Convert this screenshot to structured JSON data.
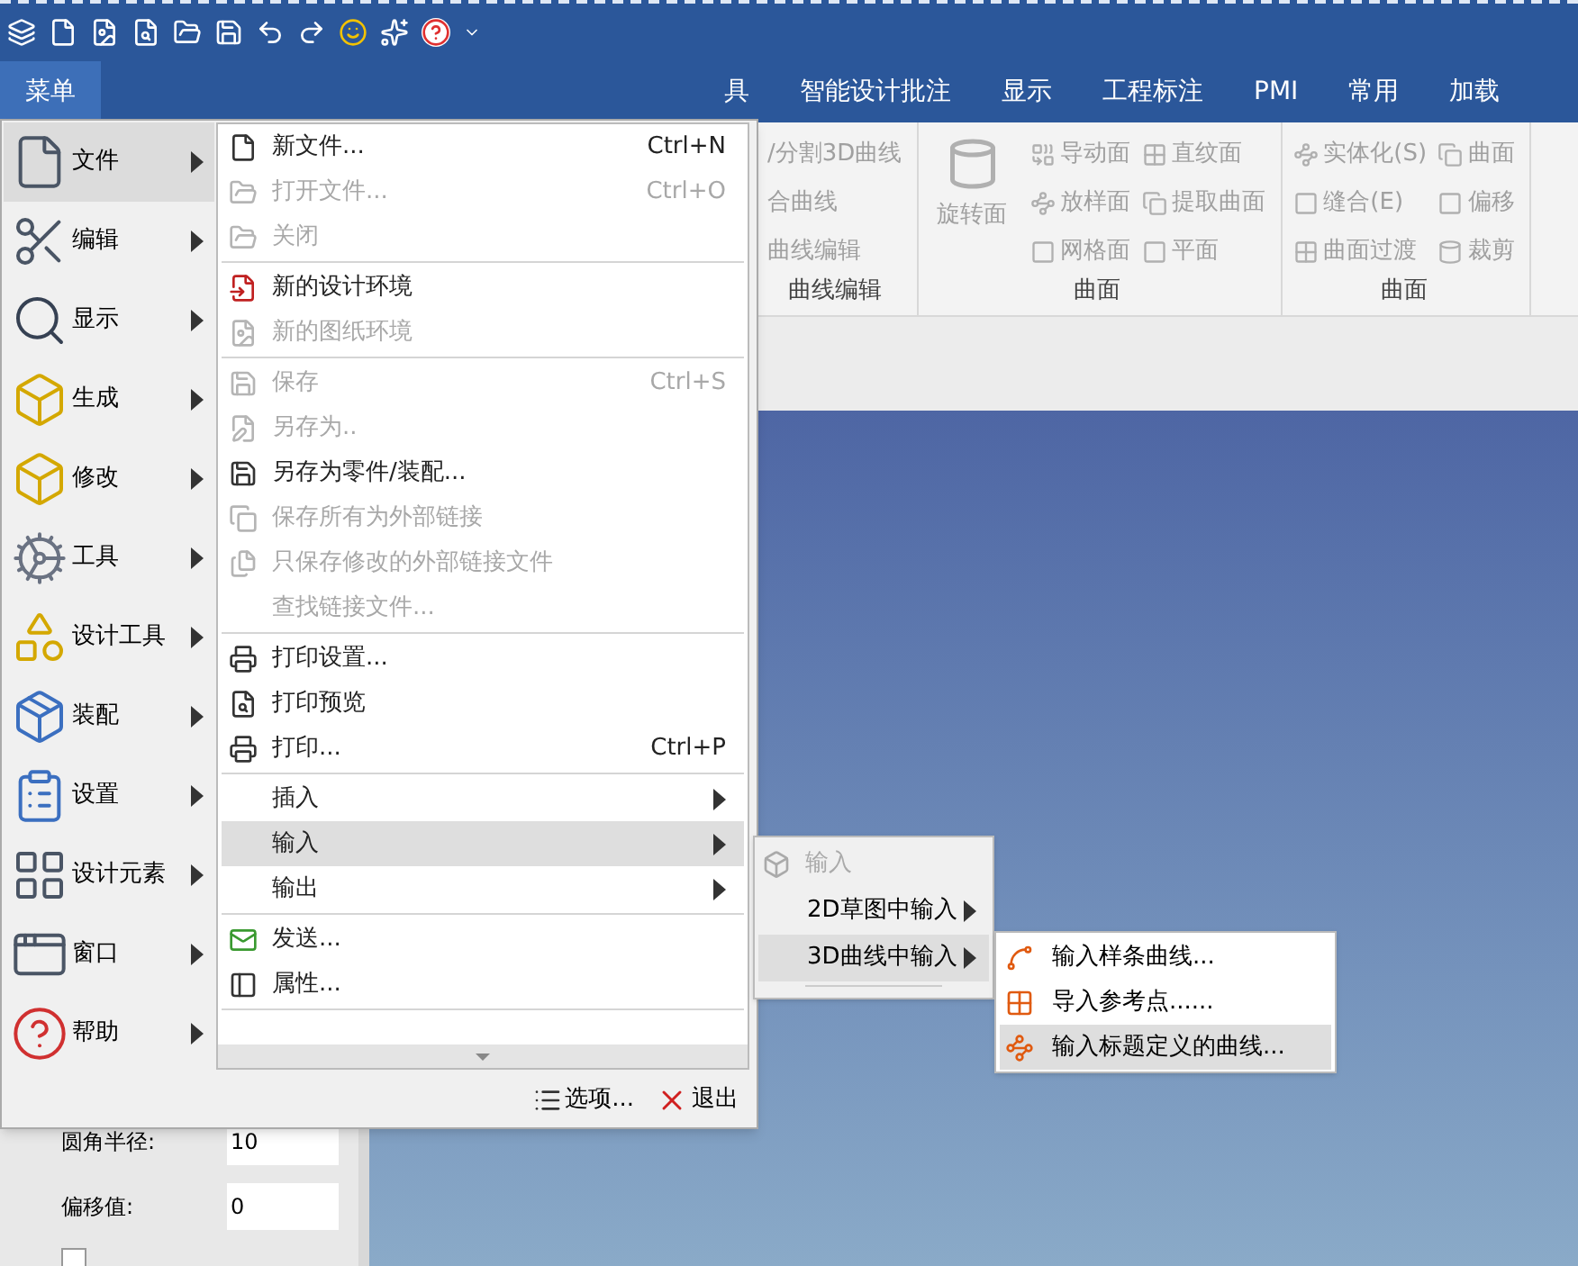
{
  "ribbon_tabs": [
    {
      "label": "菜单",
      "selected": true
    },
    {
      "label": "具",
      "selected": false
    },
    {
      "label": "智能设计批注",
      "selected": false
    },
    {
      "label": "显示",
      "selected": false
    },
    {
      "label": "工程标注",
      "selected": false
    },
    {
      "label": "PMI",
      "selected": false
    },
    {
      "label": "常用",
      "selected": false
    },
    {
      "label": "加载",
      "selected": false
    }
  ],
  "ribbon_groups": [
    {
      "label": "曲线编辑",
      "items": [
        {
          "kind": "small",
          "label": "/分割3D曲线"
        },
        {
          "kind": "small",
          "label": "合曲线"
        },
        {
          "kind": "small",
          "label": "曲线编辑"
        }
      ]
    },
    {
      "label": "曲面",
      "items": [
        {
          "kind": "large",
          "label": "旋转面"
        },
        {
          "kind": "small",
          "label": "导动面"
        },
        {
          "kind": "small",
          "label": "放样面"
        },
        {
          "kind": "small",
          "label": "网格面"
        },
        {
          "kind": "small",
          "label": "直纹面"
        },
        {
          "kind": "small",
          "label": "提取曲面"
        },
        {
          "kind": "small",
          "label": "平面"
        }
      ]
    },
    {
      "label": "曲面",
      "items": [
        {
          "kind": "small",
          "label": "实体化(S)"
        },
        {
          "kind": "small",
          "label": "缝合(E)"
        },
        {
          "kind": "small",
          "label": "曲面过渡"
        },
        {
          "kind": "small",
          "label": "曲面"
        },
        {
          "kind": "small",
          "label": "偏移"
        },
        {
          "kind": "small",
          "label": "裁剪"
        }
      ]
    }
  ],
  "side_panel": {
    "fields": [
      {
        "label": "圆角半径:",
        "value": "10"
      },
      {
        "label": "偏移值:",
        "value": "0"
      }
    ],
    "checkbox": {
      "checked": false
    }
  },
  "main_menu": {
    "categories": [
      {
        "label": "文件",
        "selected": true
      },
      {
        "label": "编辑",
        "selected": false
      },
      {
        "label": "显示",
        "selected": false
      },
      {
        "label": "生成",
        "selected": false
      },
      {
        "label": "修改",
        "selected": false
      },
      {
        "label": "工具",
        "selected": false
      },
      {
        "label": "设计工具",
        "selected": false
      },
      {
        "label": "装配",
        "selected": false
      },
      {
        "label": "设置",
        "selected": false
      },
      {
        "label": "设计元素",
        "selected": false
      },
      {
        "label": "窗口",
        "selected": false
      },
      {
        "label": "帮助",
        "selected": false
      }
    ],
    "items": [
      {
        "kind": "item",
        "label": "新文件...",
        "shortcut": "Ctrl+N",
        "disabled": false,
        "submenu": false,
        "selected": false
      },
      {
        "kind": "item",
        "label": "打开文件...",
        "shortcut": "Ctrl+O",
        "disabled": true,
        "submenu": false,
        "selected": false
      },
      {
        "kind": "item",
        "label": "关闭",
        "disabled": true,
        "submenu": false,
        "selected": false
      },
      {
        "kind": "separator"
      },
      {
        "kind": "item",
        "label": "新的设计环境",
        "disabled": false,
        "submenu": false,
        "selected": false
      },
      {
        "kind": "item",
        "label": "新的图纸环境",
        "disabled": true,
        "submenu": false,
        "selected": false
      },
      {
        "kind": "separator"
      },
      {
        "kind": "item",
        "label": "保存",
        "shortcut": "Ctrl+S",
        "disabled": true,
        "submenu": false,
        "selected": false
      },
      {
        "kind": "item",
        "label": "另存为..",
        "disabled": true,
        "submenu": false,
        "selected": false
      },
      {
        "kind": "item",
        "label": "另存为零件/装配...",
        "disabled": false,
        "submenu": false,
        "selected": false
      },
      {
        "kind": "item",
        "label": "保存所有为外部链接",
        "disabled": true,
        "submenu": false,
        "selected": false
      },
      {
        "kind": "item",
        "label": "只保存修改的外部链接文件",
        "disabled": true,
        "submenu": false,
        "selected": false
      },
      {
        "kind": "item",
        "label": "查找链接文件...",
        "disabled": true,
        "submenu": false,
        "selected": false
      },
      {
        "kind": "separator"
      },
      {
        "kind": "item",
        "label": "打印设置...",
        "disabled": false,
        "submenu": false,
        "selected": false
      },
      {
        "kind": "item",
        "label": "打印预览",
        "disabled": false,
        "submenu": false,
        "selected": false
      },
      {
        "kind": "item",
        "label": "打印...",
        "shortcut": "Ctrl+P",
        "disabled": false,
        "submenu": false,
        "selected": false
      },
      {
        "kind": "separator"
      },
      {
        "kind": "item",
        "label": "插入",
        "disabled": false,
        "submenu": true,
        "selected": false
      },
      {
        "kind": "item",
        "label": "输入",
        "disabled": false,
        "submenu": true,
        "selected": true
      },
      {
        "kind": "item",
        "label": "输出",
        "disabled": false,
        "submenu": true,
        "selected": false
      },
      {
        "kind": "separator"
      },
      {
        "kind": "item",
        "label": "发送...",
        "disabled": false,
        "submenu": false,
        "selected": false
      },
      {
        "kind": "item",
        "label": "属性...",
        "disabled": false,
        "submenu": false,
        "selected": false
      },
      {
        "kind": "separator"
      }
    ],
    "footer": [
      {
        "label": "选项..."
      },
      {
        "label": "退出"
      }
    ]
  },
  "input_submenu": {
    "header": "输入",
    "items": [
      {
        "label": "2D草图中输入",
        "submenu": true,
        "selected": false
      },
      {
        "label": "3D曲线中输入",
        "submenu": true,
        "selected": true
      }
    ]
  },
  "curve_submenu": {
    "items": [
      {
        "label": "输入样条曲线...",
        "selected": false
      },
      {
        "label": "导入参考点......",
        "selected": false
      },
      {
        "label": "输入标题定义的曲线...",
        "selected": true
      }
    ]
  }
}
